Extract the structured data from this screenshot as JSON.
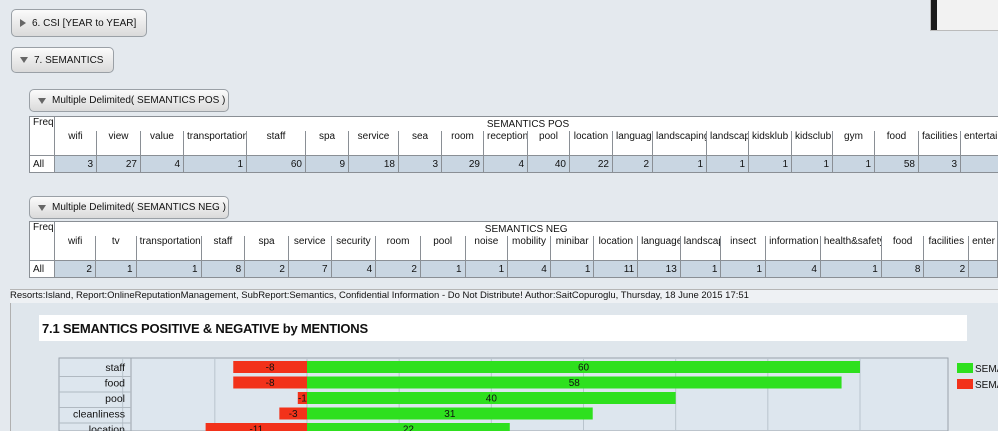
{
  "outline": {
    "csi_label": "6. CSI [YEAR to YEAR]",
    "semantics_label": "7. SEMANTICS",
    "pos_label": "Multiple Delimited( SEMANTICS POS )",
    "neg_label": "Multiple Delimited( SEMANTICS NEG )"
  },
  "pos_table": {
    "stub": "Freq",
    "group": "SEMANTICS POS",
    "row_label": "All",
    "columns": [
      "wifi",
      "view",
      "value",
      "transportation",
      "staff",
      "spa",
      "service",
      "sea",
      "room",
      "reception",
      "pool",
      "location",
      "language",
      "landscaping",
      "landscape",
      "kidsklub",
      "kidsclub",
      "gym",
      "food",
      "facilities",
      "entertain"
    ],
    "values": [
      "3",
      "27",
      "4",
      "1",
      "60",
      "9",
      "18",
      "3",
      "29",
      "4",
      "40",
      "22",
      "2",
      "1",
      "1",
      "1",
      "1",
      "1",
      "58",
      "3",
      ""
    ]
  },
  "neg_table": {
    "stub": "Freq",
    "group": "SEMANTICS NEG",
    "row_label": "All",
    "columns": [
      "wifi",
      "tv",
      "transportation",
      "staff",
      "spa",
      "service",
      "security",
      "room",
      "pool",
      "noise",
      "mobility",
      "minibar",
      "location",
      "language",
      "landscape",
      "insect",
      "information",
      "health&safety",
      "food",
      "facilities",
      "enter"
    ],
    "values": [
      "2",
      "1",
      "1",
      "8",
      "2",
      "7",
      "4",
      "2",
      "1",
      "1",
      "4",
      "1",
      "11",
      "13",
      "1",
      "1",
      "4",
      "1",
      "8",
      "2",
      ""
    ]
  },
  "footer_text": "Resorts:Island, Report:OnlineReputationManagement, SubReport:Semantics, Confidential Information - Do Not Distribute! Author:SaitCopuroglu,  Thursday, 18 June 2015 17:51",
  "chart_title": "7.1 SEMANTICS POSITIVE & NEGATIVE by MENTIONS",
  "chart_data": {
    "type": "bar",
    "orientation": "horizontal-diverging",
    "title": "7.1 SEMANTICS POSITIVE & NEGATIVE by MENTIONS",
    "categories": [
      "staff",
      "food",
      "pool",
      "cleanliness",
      "location"
    ],
    "series": [
      {
        "name": "SEMA",
        "color": "#2ee01e",
        "values": [
          60,
          58,
          40,
          31,
          22
        ]
      },
      {
        "name": "SEMA",
        "color": "#f2321a",
        "values": [
          -8,
          -8,
          -1,
          -3,
          -11
        ]
      }
    ],
    "grid": true,
    "legend": "right"
  },
  "colors": {
    "positive": "#2ee01e",
    "negative": "#f2321a"
  }
}
